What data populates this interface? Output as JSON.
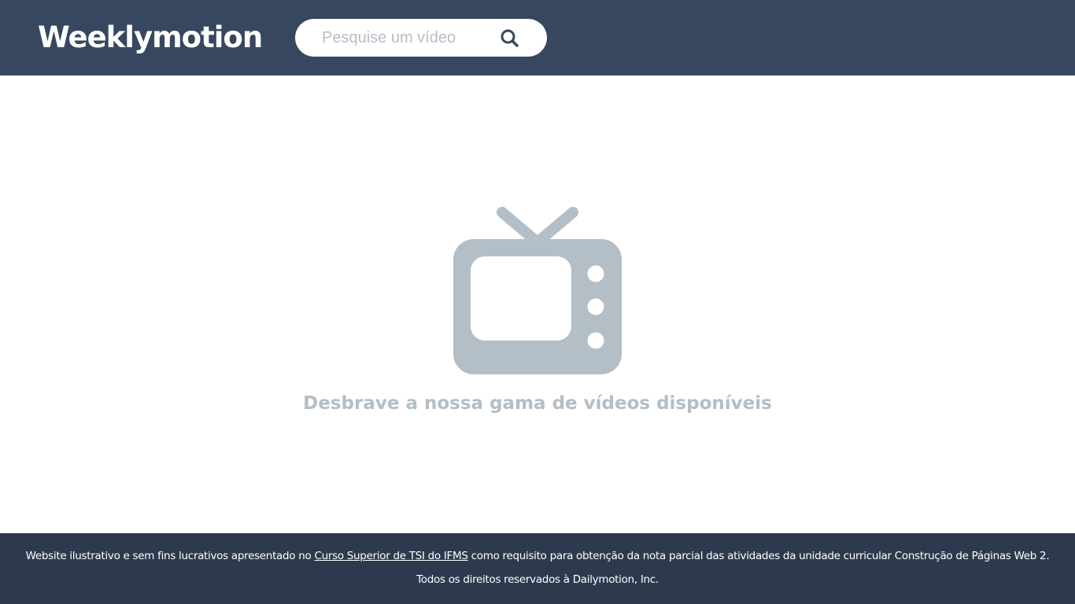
{
  "header": {
    "logo": "Weeklymotion",
    "search": {
      "placeholder": "Pesquise um vídeo",
      "value": "",
      "button_icon": "search-icon"
    }
  },
  "main": {
    "icon": "tv-icon",
    "message": "Desbrave a nossa gama de vídeos disponíveis"
  },
  "footer": {
    "line1_before": "Website ilustrativo e sem fins lucrativos apresentado no ",
    "link_text": "Curso Superior de TSI do IFMS",
    "line1_after": " como requisito para obtenção da nota parcial das atividades da unidade curricular Construção de Páginas Web 2.",
    "line2": "Todos os direitos reservados à Dailymotion, Inc."
  },
  "colors": {
    "header_bg": "#37475f",
    "footer_bg": "#2d3a4e",
    "icon_gray": "#b3bec6",
    "text_white": "#ffffff"
  }
}
